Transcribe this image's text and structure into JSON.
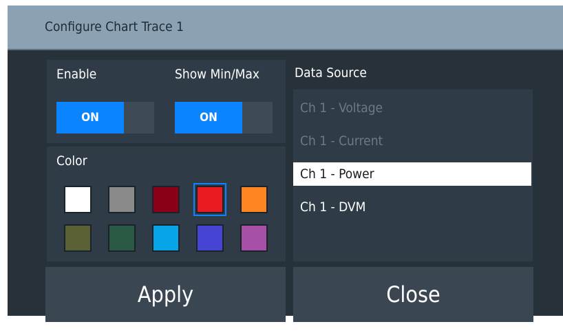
{
  "dialog": {
    "title": "Configure Chart Trace 1"
  },
  "enable": {
    "label": "Enable",
    "state": "ON"
  },
  "show_min_max": {
    "label": "Show Min/Max",
    "state": "ON"
  },
  "color": {
    "label": "Color",
    "swatches": [
      {
        "name": "white",
        "hex": "#ffffff",
        "selected": false
      },
      {
        "name": "gray",
        "hex": "#8a8a8a",
        "selected": false
      },
      {
        "name": "maroon",
        "hex": "#8b0016",
        "selected": false
      },
      {
        "name": "red",
        "hex": "#ea1a22",
        "selected": true
      },
      {
        "name": "orange",
        "hex": "#ff8422",
        "selected": false
      },
      {
        "name": "olive",
        "hex": "#5a5f34",
        "selected": false
      },
      {
        "name": "dark-green",
        "hex": "#2a5a43",
        "selected": false
      },
      {
        "name": "sky-blue",
        "hex": "#07a5e8",
        "selected": false
      },
      {
        "name": "indigo",
        "hex": "#4644d2",
        "selected": false
      },
      {
        "name": "purple",
        "hex": "#a650a8",
        "selected": false
      }
    ]
  },
  "data_source": {
    "label": "Data Source",
    "items": [
      {
        "label": "Ch 1 - Voltage",
        "state": "disabled"
      },
      {
        "label": "Ch 1 - Current",
        "state": "disabled"
      },
      {
        "label": "Ch 1 - Power",
        "state": "selected"
      },
      {
        "label": "Ch 1 - DVM",
        "state": "enabled"
      }
    ]
  },
  "buttons": {
    "apply": "Apply",
    "close": "Close"
  },
  "colors": {
    "accent": "#0a84ff",
    "titlebar": "#8aa2b4",
    "background": "#26313a",
    "panel": "#2f3c47"
  }
}
